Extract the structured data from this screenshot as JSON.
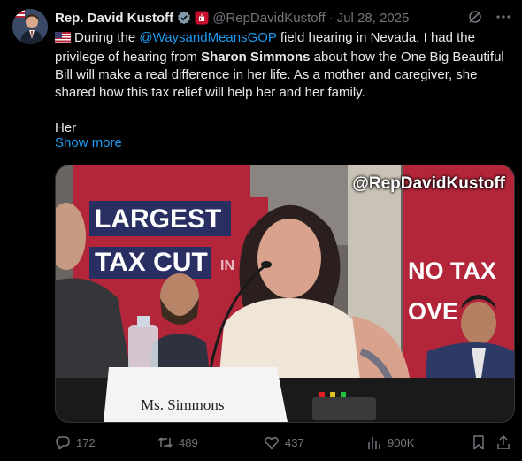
{
  "tweet": {
    "author_name": "Rep. David Kustoff",
    "handle": "@RepDavidKustoff",
    "date": "Jul 28, 2025",
    "text": {
      "part1": "During the ",
      "mention": "@WaysandMeansGOP",
      "part2": " field hearing in Nevada, I had the privilege of hearing from ",
      "bold_name": "Sharon Simmons",
      "part3": " about how the One Big Beautiful Bill will make a real difference in her life. As a mother and caregiver, she shared how this tax relief will help her and her family.",
      "part4": "Her"
    },
    "show_more": "Show more"
  },
  "media": {
    "watermark": "@RepDavidKustoff",
    "sign_largest": "LARGEST",
    "sign_tax_cut": "TAX CUT",
    "sign_in": "IN",
    "sign_right": "NO TAX",
    "sign_right2": "OVE",
    "nameplate": "Ms. Simmons"
  },
  "actions": {
    "replies": "172",
    "reposts": "489",
    "likes": "437",
    "views": "900K"
  },
  "colors": {
    "accent": "#1d9bf0",
    "muted": "#71767b",
    "text": "#e7e9ea"
  }
}
